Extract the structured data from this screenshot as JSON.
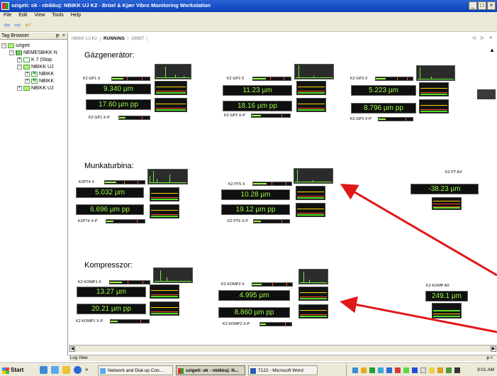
{
  "window": {
    "title": "szigeti: ok - nbikkuj: NBIKK UJ K2 - Brüel & Kjær Vibro Monitoring Workstation",
    "controls": [
      "_",
      "□",
      "×"
    ]
  },
  "menu": [
    "File",
    "Edit",
    "View",
    "Tools",
    "Help"
  ],
  "tag_browser": {
    "title": "Tag Browser",
    "pin": "ᵽ",
    "close": "×",
    "tree": [
      {
        "label": "szigeti",
        "level": 0,
        "toggle": "−",
        "icon": "folder"
      },
      {
        "label": "NEMESBIKK N",
        "level": 1,
        "toggle": "−",
        "icon": "bars"
      },
      {
        "label": "K 7 (Stop",
        "level": 2,
        "toggle": "+",
        "icon": "k"
      },
      {
        "label": "NBIKK UJ",
        "level": 2,
        "toggle": "−",
        "icon": "folder"
      },
      {
        "label": "NBIKK",
        "level": 3,
        "toggle": "+",
        "icon": "n"
      },
      {
        "label": "NBIKK",
        "level": 3,
        "toggle": "+",
        "icon": "n"
      },
      {
        "label": "NBIKK UJ",
        "level": 2,
        "toggle": "+",
        "icon": "folder"
      }
    ]
  },
  "tabs": [
    {
      "label": "NBIKK UJ K2",
      "active": false
    },
    {
      "label": "RUNNING",
      "active": true
    },
    {
      "label": "ORBIT",
      "active": false
    }
  ],
  "tab_nav": "◁ ▷ ×",
  "sections": [
    {
      "title": "Gázgenerátor:"
    },
    {
      "title": "Munkaturbina:"
    },
    {
      "title": "Kompresszor:"
    }
  ],
  "channels": {
    "gp1": {
      "label_x": "K2 GP1 X",
      "value": "9.340 µm",
      "pp": "17.60 µm pp",
      "label_xp": "K2 GP1 X-P"
    },
    "gp2": {
      "label_x": "K2 GP2 X",
      "value": "11.23 µm",
      "pp": "18.16 µm pp",
      "label_xp": "K2 GP2 X-P"
    },
    "gp3": {
      "label_x": "K2 GP3 X",
      "value": "5.223 µm",
      "pp": "8.796 µm pp",
      "label_xp": "K2 GP3 X-P"
    },
    "pt4": {
      "label_x": "K2PT4 X",
      "value": "5.032 µm",
      "pp": "6.696 µm pp",
      "label_xp": "K2PT4 X-P"
    },
    "pt5": {
      "label_x": "K2 PT5 X",
      "value": "10.28 µm",
      "pp": "19.12 µm pp",
      "label_xp": "K2 PT5 X-P"
    },
    "ptax": {
      "label": "K2 PT AX",
      "value": "-38.23 µm"
    },
    "komp1": {
      "label_x": "K2 KOMP1 X",
      "value": "13.27 µm",
      "pp": "20.21 µm pp",
      "label_xp": "K2 KOMP1 X-P"
    },
    "komp2": {
      "label_x": "K2 KOMP2 X",
      "value": "4.995 µm",
      "pp": "8.860 µm pp",
      "label_xp": "K2 KOMP2 X-P"
    },
    "kompax": {
      "label": "K2 KOMP AX",
      "value": "249.1 µm"
    }
  },
  "log_view": {
    "title": "Log View",
    "pin": "ᵽ ×"
  },
  "taskbar": {
    "start": "Start",
    "chevron": "»",
    "items": [
      {
        "label": "Network and Dial-up Con...",
        "active": false
      },
      {
        "label": "szigeti: ok - nbikkuj: N...",
        "active": true
      },
      {
        "label": "7122 - Microsoft Word",
        "active": false
      }
    ],
    "clock": "9:01 AM"
  },
  "colors": {
    "title_blue": "#0a3fb6",
    "value_green": "#9cff45",
    "alarm_red": "#ff4a2a",
    "annotation_red": "#e01818"
  }
}
